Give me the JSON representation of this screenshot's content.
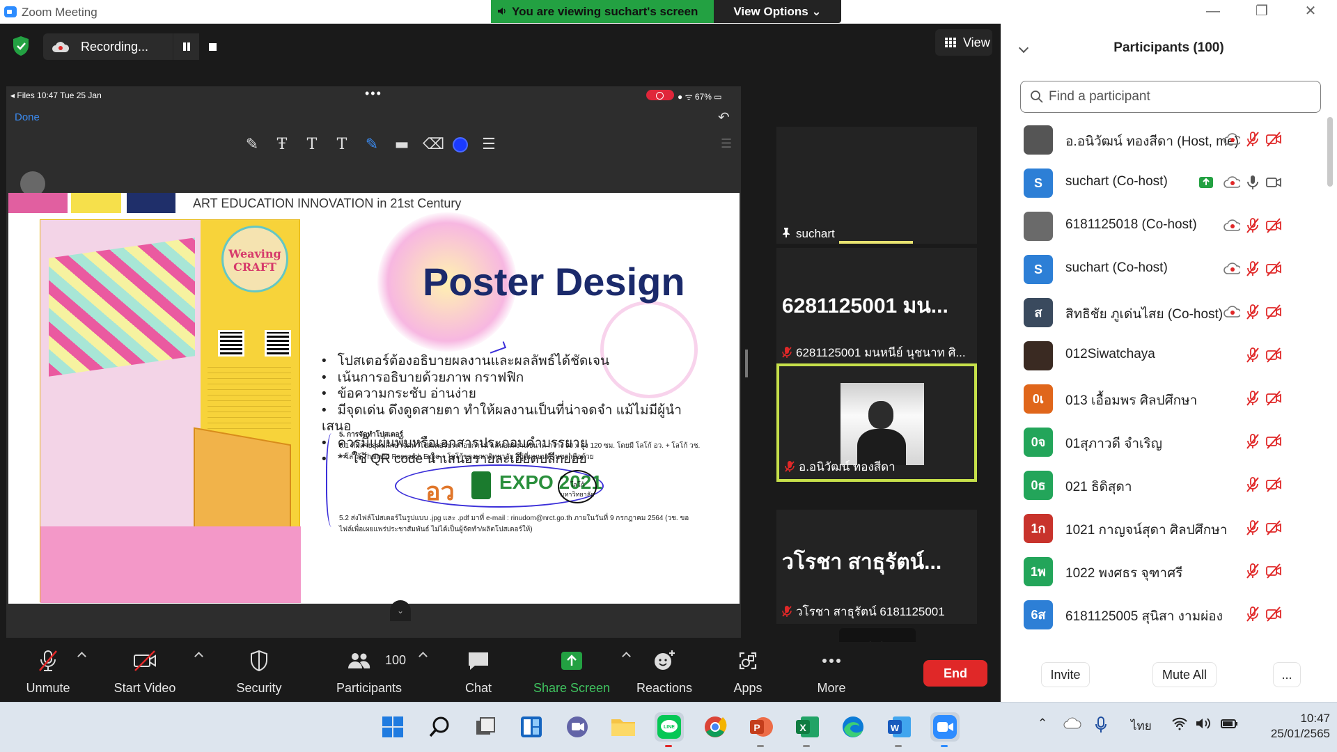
{
  "window": {
    "title": "Zoom Meeting",
    "minimize": "—",
    "maximize": "❐",
    "close": "✕"
  },
  "banner": {
    "viewing_text": "You are viewing suchart's screen",
    "view_options": "View Options ⌄"
  },
  "meeting": {
    "recording_label": "Recording...",
    "view_label": "View"
  },
  "shared_screen": {
    "status_left": "◂ Files  10:47  Tue 25 Jan",
    "status_dots": "•••",
    "status_right": "● ᯤ 67% ▭",
    "done_label": "Done",
    "undo": "↶",
    "tools": [
      "✎",
      "Ŧ",
      "T",
      "T",
      "✎",
      "▬",
      "⌫"
    ],
    "list_icon": "☰",
    "slide": {
      "header": "ART EDUCATION INNOVATION in 21st Century",
      "title": "Poster Design",
      "poster_word": "Weaving CRAFT",
      "bullets": [
        "โปสเตอร์ต้องอธิบายผลงานและผลลัพธ์ได้ชัดเจน",
        "เน้นการอธิบายด้วยภาพ กราฟฟิก",
        "ข้อความกระชับ อ่านง่าย",
        "มีจุดเด่น ดึงดูดสายตา ทำให้ผลงานเป็นที่น่าจดจำ แม้ไม่มีผู้นำเสนอ",
        "ควรมีแผ่นพับหรือเอกสารประกอบคำบรรยาย",
        "** ใช้ QR code นำเสนอรายละเอียดปลีกย่อย"
      ],
      "note_heading": "5. การจัดทำโปสเตอร์",
      "note_1": "5.1 ทีมสายอุดมศึกษาจัดทำโปสเตอร์ประกอบการนำเสนอผลงานขนาด กว้าง 90 x สูง 120 ซม. โดยมี โลโก้ อว. + โลโก้ วช. + โลโก้ Thailand Research Expo + โลโก้ของมหาวิทยาลัย อยู่ที่มุมบนด้านขวามือด้วย",
      "note_2": "5.2 ส่งไฟล์โปสเตอร์ในรูปแบบ .jpg และ .pdf มาที่ e-mail : rinudom@nrct.go.th ภายในวันที่ 9 กรกฎาคม 2564 (วช. ขอไฟล์เพื่อเผยแพร่ประชาสัมพันธ์ ไม่ได้เป็นผู้จัดทำ/ผลิตโปสเตอร์ให้)",
      "logo_1": "อว",
      "logo_3": "EXPO 2021",
      "logo_4": "โลโก้ มหาวิทยาลัย"
    },
    "chevron": "⌄"
  },
  "videos": [
    {
      "name": "suchart",
      "big": ""
    },
    {
      "name": "6281125001 มนหนีย์ นุชนาท ศิ...",
      "big": "6281125001 มน..."
    },
    {
      "name": "อ.อนิวัฒน์ ทองสีดา",
      "big": ""
    },
    {
      "name": "วโรชา สาธุรัตน์ 6181125001",
      "big": "วโรชา สาธุรัตน์..."
    }
  ],
  "toolbar": {
    "unmute": "Unmute",
    "start_video": "Start Video",
    "security": "Security",
    "participants": "Participants",
    "participants_count": "100",
    "chat": "Chat",
    "share_screen": "Share Screen",
    "reactions": "Reactions",
    "apps": "Apps",
    "more": "More",
    "end": "End"
  },
  "participants_panel": {
    "title": "Participants (100)",
    "search_placeholder": "Find a participant",
    "invite": "Invite",
    "mute_all": "Mute All",
    "more": "...",
    "list": [
      {
        "name": "อ.อนิวัฒน์ ทองสีดา (Host, me)",
        "avatar": "",
        "color": "#555555"
      },
      {
        "name": "suchart (Co-host)",
        "avatar": "S",
        "color": "#2d7fd6"
      },
      {
        "name": "6181125018 (Co-host)",
        "avatar": "",
        "color": "#6a6a6a"
      },
      {
        "name": "suchart (Co-host)",
        "avatar": "S",
        "color": "#2d7fd6"
      },
      {
        "name": "สิทธิชัย ภูเด่นไสย (Co-host)",
        "avatar": "ส",
        "color": "#3a4a5e"
      },
      {
        "name": "012Siwatchaya",
        "avatar": "",
        "color": "#3a2a22"
      },
      {
        "name": "013 เอื้อมพร ศิลปศึกษา",
        "avatar": "0เ",
        "color": "#e0661b"
      },
      {
        "name": "01สุภาวดี จำเริญ",
        "avatar": "0จ",
        "color": "#23a55a"
      },
      {
        "name": "021 ธิดิสุดา",
        "avatar": "0ธ",
        "color": "#23a55a"
      },
      {
        "name": "1021 กาญจน์สุดา ศิลปศึกษา",
        "avatar": "1ก",
        "color": "#c8332c"
      },
      {
        "name": "1022 พงศธร จุฑาศรี",
        "avatar": "1พ",
        "color": "#23a55a"
      },
      {
        "name": "6181125005 สุนิสา งามผ่อง",
        "avatar": "6ส",
        "color": "#2d7fd6"
      }
    ]
  },
  "taskbar": {
    "tray_language": "ไทย",
    "tray_chevron": "⌃",
    "time": "10:47",
    "date": "25/01/2565"
  }
}
